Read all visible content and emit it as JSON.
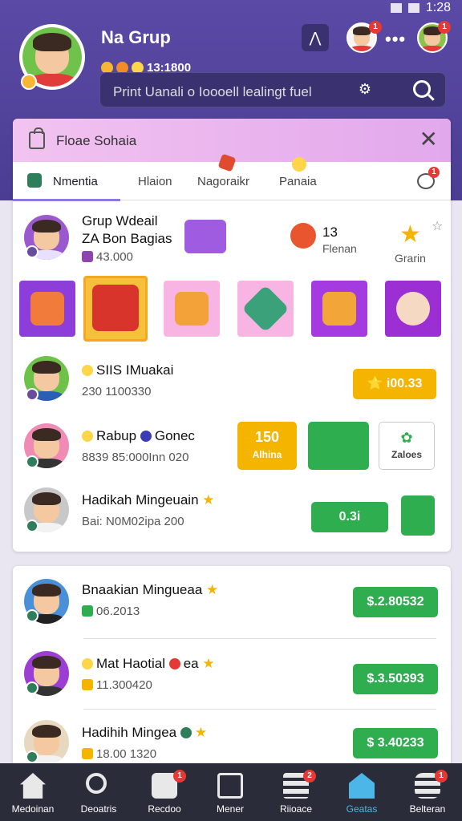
{
  "status_bar": {
    "time": "1:28"
  },
  "header": {
    "title": "Na Grup",
    "coins": "13:1800",
    "search_placeholder": "Print Uanali o Ioooell lealingt fuel",
    "notif_badge_1": "1",
    "notif_badge_2": "1",
    "colors": {
      "header_bg": "#4a3d92",
      "accent": "#8c7bdc"
    }
  },
  "panel": {
    "title": "Floae Sohaia",
    "tabs": [
      {
        "label": "Nmentia"
      },
      {
        "label": "Hlaion"
      },
      {
        "label": "Nagoraikr"
      },
      {
        "label": "Panaia"
      }
    ],
    "chat_badge": "1",
    "group_row": {
      "line1": "Grup Wdeail",
      "line2": "ZA Bon Bagias",
      "amount": "43.000",
      "stat_value": "13",
      "stat_label": "Flenan",
      "star_label": "Grarin"
    },
    "players": [
      {
        "name": "SIIS IMuakai",
        "score": "230  1100330",
        "action": "⭐ i00.33"
      },
      {
        "name": "Rabup",
        "name2": "Gonec",
        "score": "8839  85:000Inn 020",
        "badge_big": "150",
        "badge_sub": "Alhina",
        "stat_label": "Zaloes"
      },
      {
        "name": "Hadikah Mingeuain",
        "score": "Bai: N0M02ipa 200",
        "action": "0.3i"
      }
    ]
  },
  "leaderboard": [
    {
      "name": "Bnaakian Mingueaa",
      "score": "06.2013",
      "amount": "$.2.80532"
    },
    {
      "name": "Mat Haotial",
      "name_suffix": "ea",
      "score": "11.300420",
      "amount": "$.3.50393"
    },
    {
      "name": "Hadihih Mingea",
      "score": "18.00 1320",
      "amount": "$ 3.40233"
    }
  ],
  "bottom_nav": [
    {
      "label": "Medoinan",
      "icon": "home-icon"
    },
    {
      "label": "Deoatris",
      "icon": "search-icon"
    },
    {
      "label": "Recdoo",
      "icon": "gift-icon",
      "badge": "1"
    },
    {
      "label": "Mener",
      "icon": "list-icon"
    },
    {
      "label": "Riioace",
      "icon": "stack-icon",
      "badge": "2"
    },
    {
      "label": "Geatas",
      "icon": "shop-icon"
    },
    {
      "label": "Belteran",
      "icon": "coins-icon",
      "badge": "1"
    }
  ]
}
